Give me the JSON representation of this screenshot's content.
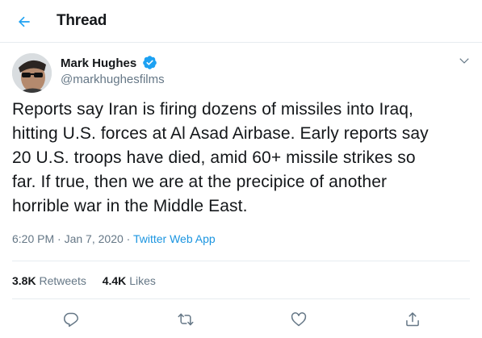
{
  "header": {
    "title": "Thread",
    "back_icon": "arrow-left-icon",
    "accent_color": "#1da1f2"
  },
  "author": {
    "name": "Mark Hughes",
    "handle": "@markhughesfilms",
    "verified": true,
    "verified_icon": "verified-badge-icon"
  },
  "tweet": {
    "text_lines": [
      "Reports say Iran is firing dozens of missiles into Iraq,",
      "hitting U.S. forces at Al Asad Airbase. Early reports say",
      "20 U.S. troops have died, amid 60+ missile strikes so",
      "far. If true, then we are at the precipice of another",
      "horrible war in the Middle East."
    ],
    "time": "6:20 PM",
    "separator": "·",
    "date": "Jan 7, 2020",
    "source": "Twitter Web App"
  },
  "stats": {
    "retweets_count": "3.8K",
    "retweets_label": "Retweets",
    "likes_count": "4.4K",
    "likes_label": "Likes"
  },
  "actions": [
    "reply-icon",
    "retweet-icon",
    "like-icon",
    "share-icon"
  ],
  "colors": {
    "text": "#14171a",
    "secondary": "#657786",
    "link": "#1b95e0",
    "border": "#e6ecf0"
  }
}
